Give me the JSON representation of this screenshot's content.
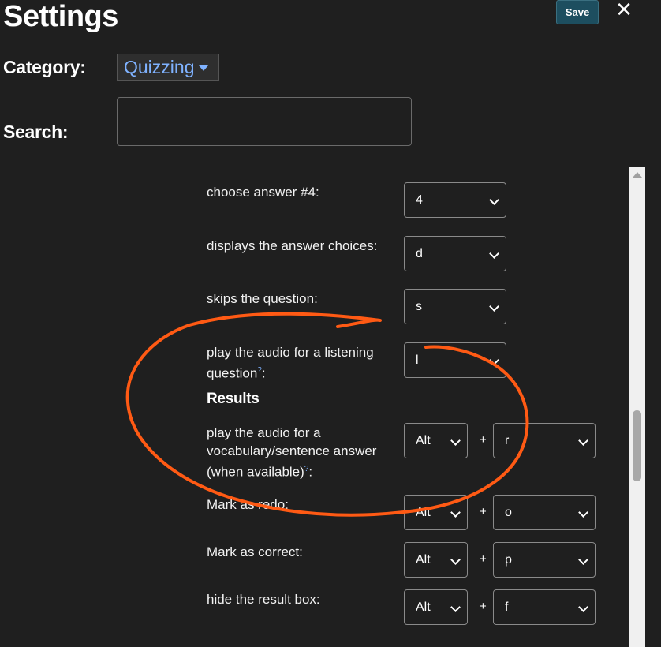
{
  "header": {
    "title": "Settings",
    "save_label": "Save",
    "close_label": "✕"
  },
  "category": {
    "label": "Category:",
    "value": "Quizzing"
  },
  "search": {
    "label": "Search:",
    "value": ""
  },
  "rows": [
    {
      "label": "choose answer #4:",
      "key": "4"
    },
    {
      "label": "displays the answer choices:",
      "key": "d"
    },
    {
      "label": "skips the question:",
      "key": "s"
    },
    {
      "label_line1": "play the audio for a listening",
      "label_line2": "question",
      "help": "?",
      "suffix": ":",
      "key": "l"
    }
  ],
  "results": {
    "heading": "Results",
    "rows": [
      {
        "label_line1": "play the audio for a",
        "label_line2": "vocabulary/sentence answer",
        "label_line3": "(when available)",
        "help": "?",
        "suffix": ":",
        "modifier": "Alt",
        "plus": "+",
        "key": "r"
      },
      {
        "label": "Mark as redo:",
        "modifier": "Alt",
        "plus": "+",
        "key": "o"
      },
      {
        "label": "Mark as correct:",
        "modifier": "Alt",
        "plus": "+",
        "key": "p"
      },
      {
        "label": "hide the result box:",
        "modifier": "Alt",
        "plus": "+",
        "key": "f"
      }
    ]
  },
  "colors": {
    "background": "#1f1f1f",
    "save_button": "#1d4e5f",
    "link": "#7fb2ff",
    "annotation": "#ff5a14"
  }
}
